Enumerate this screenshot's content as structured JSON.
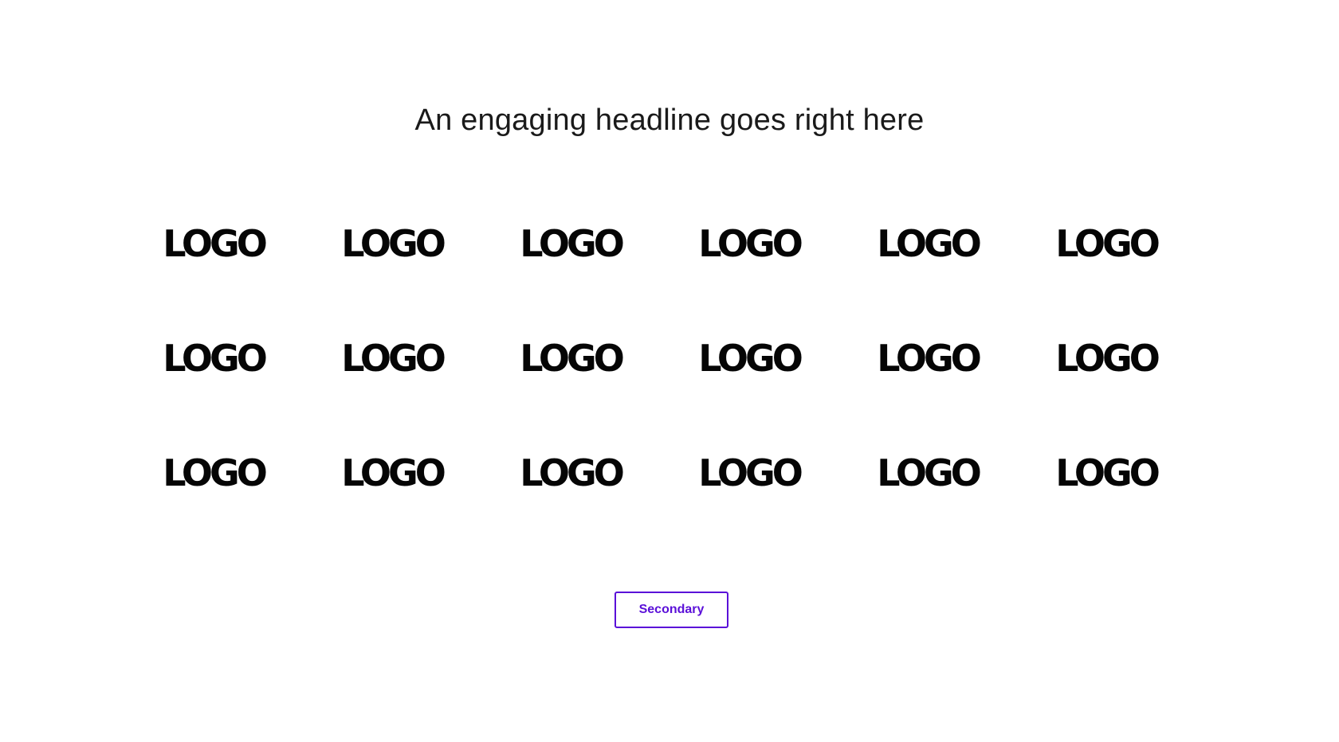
{
  "headline": "An engaging headline goes right here",
  "logos": [
    "LOGO",
    "LOGO",
    "LOGO",
    "LOGO",
    "LOGO",
    "LOGO",
    "LOGO",
    "LOGO",
    "LOGO",
    "LOGO",
    "LOGO",
    "LOGO",
    "LOGO",
    "LOGO",
    "LOGO",
    "LOGO",
    "LOGO",
    "LOGO"
  ],
  "cta": {
    "secondary_label": "Secondary"
  },
  "colors": {
    "accent": "#5a0fd8",
    "text": "#111111",
    "background": "#ffffff"
  }
}
